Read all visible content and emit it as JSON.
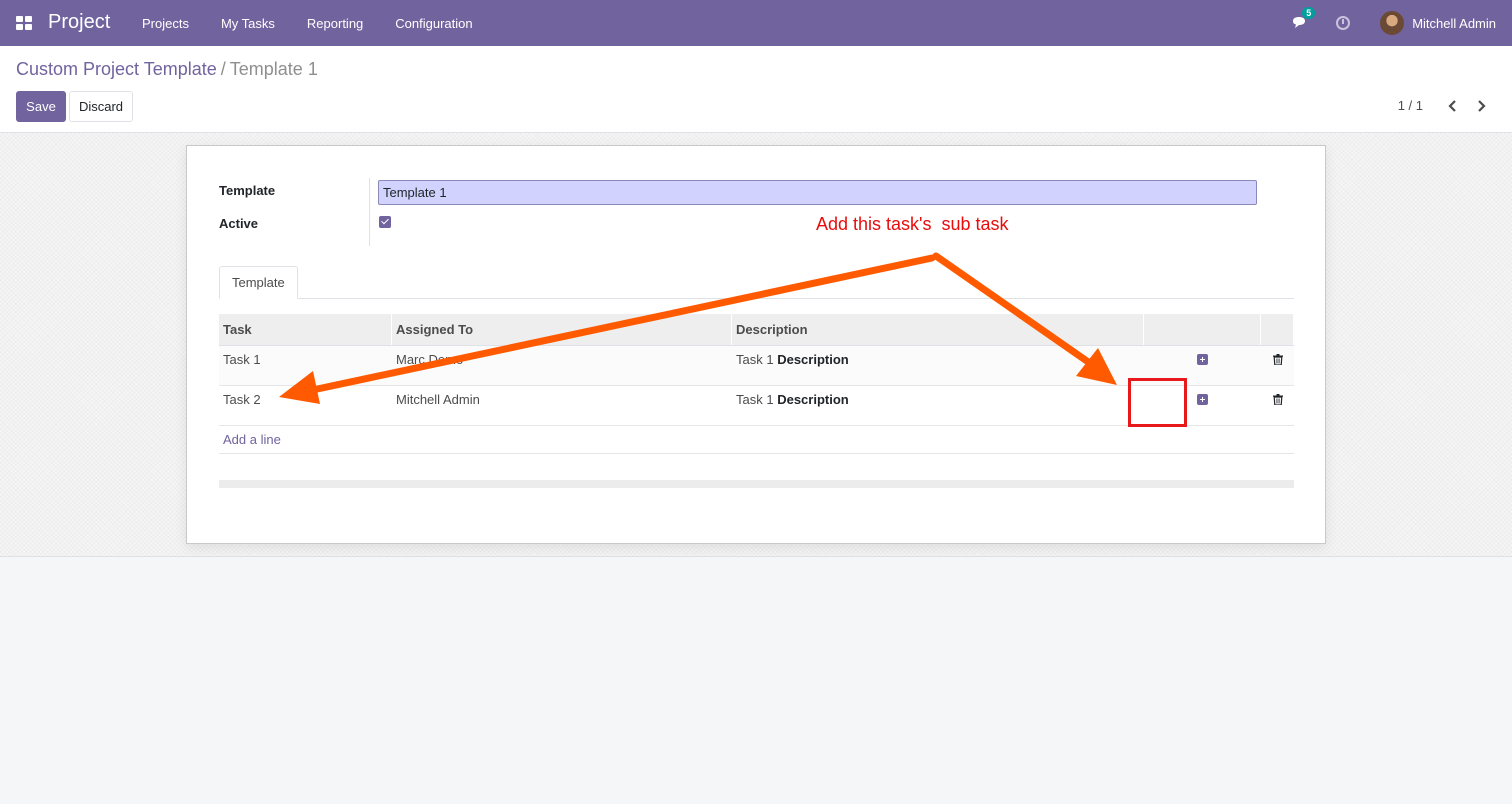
{
  "navbar": {
    "app_name": "Project",
    "menu": [
      "Projects",
      "My Tasks",
      "Reporting",
      "Configuration"
    ],
    "chat_badge": "5",
    "user_name": "Mitchell Admin",
    "color": "#71639e"
  },
  "breadcrumb": {
    "parent": "Custom Project Template",
    "separator": "/",
    "current": "Template 1"
  },
  "buttons": {
    "save": "Save",
    "discard": "Discard"
  },
  "pager": "1 / 1",
  "form": {
    "template_label": "Template",
    "template_value": "Template 1",
    "active_label": "Active",
    "active_checked": true,
    "tab_label": "Template"
  },
  "grid": {
    "columns": {
      "task": "Task",
      "assigned": "Assigned To",
      "description": "Description"
    },
    "rows": [
      {
        "task": "Task 1",
        "assigned": "Marc Demo",
        "desc_prefix": "Task 1",
        "desc_bold": "Description"
      },
      {
        "task": "Task 2",
        "assigned": "Mitchell Admin",
        "desc_prefix": "Task 1",
        "desc_bold": "Description"
      }
    ],
    "add_line": "Add a line"
  },
  "annotation": {
    "text": "Add this task's  sub task",
    "color": "#e80c0c",
    "arrow_color": "#ff5a00"
  }
}
